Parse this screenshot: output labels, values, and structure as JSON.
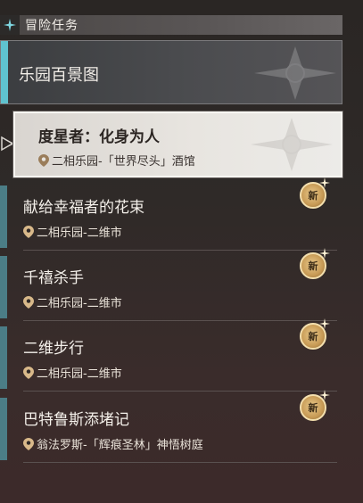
{
  "header": {
    "title": "冒险任务"
  },
  "featured": {
    "label": "乐园百景图"
  },
  "active": {
    "title": "度星者：化身为人",
    "location": "二相乐园-「世界尽头」酒馆"
  },
  "items": [
    {
      "title": "献给幸福者的花束",
      "location": "二相乐园-二维市",
      "badge": "新"
    },
    {
      "title": "千禧杀手",
      "location": "二相乐园-二维市",
      "badge": "新"
    },
    {
      "title": "二维步行",
      "location": "二相乐园-二维市",
      "badge": "新"
    },
    {
      "title": "巴特鲁斯添堵记",
      "location": "翁法罗斯-「辉痕圣林」神悟树庭",
      "badge": "新"
    }
  ],
  "colors": {
    "accent": "#5fc3cf",
    "badge": "#c79a55",
    "active_bg": "#e8e5e0"
  }
}
